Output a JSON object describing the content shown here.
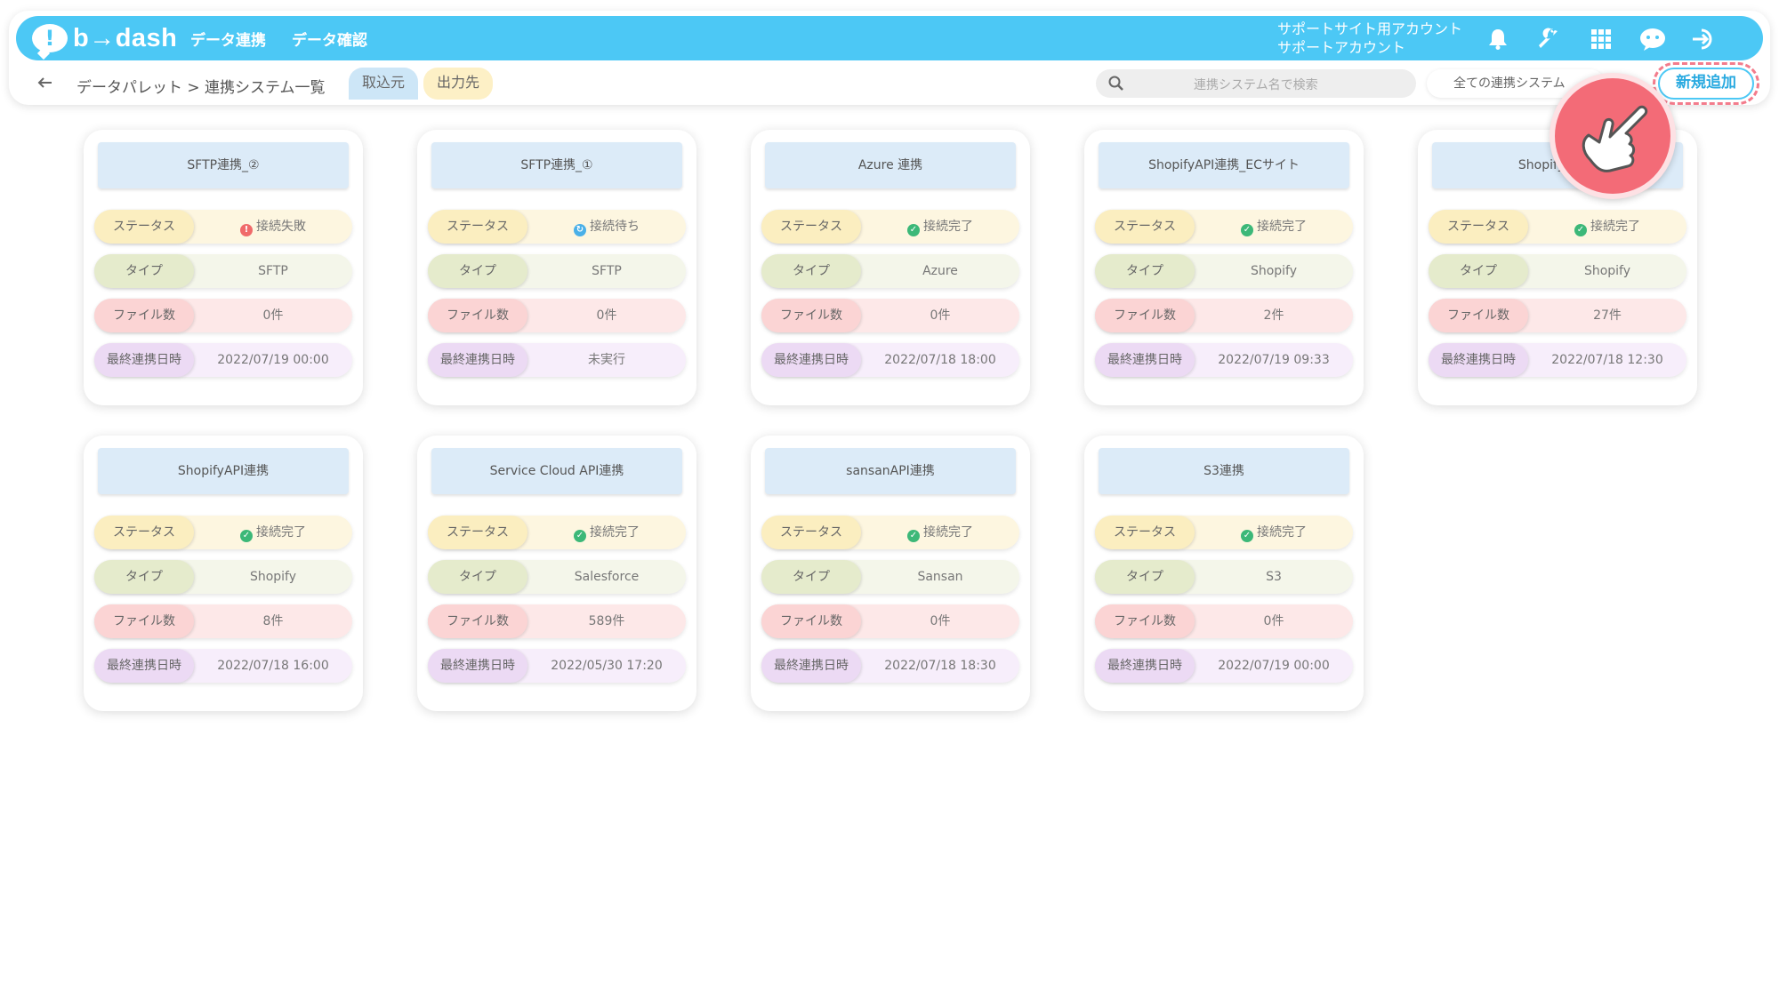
{
  "header": {
    "logo_text": "b→dash",
    "nav": [
      "データ連携",
      "データ確認"
    ],
    "account_line1": "サポートサイト用アカウント",
    "account_line2": "サポートアカウント",
    "icons": [
      "bell-icon",
      "wrench-icon",
      "grid-icon",
      "chat-icon",
      "logout-icon"
    ]
  },
  "subbar": {
    "breadcrumb": "データパレット > 連携システム一覧",
    "tab_import": "取込元",
    "tab_export": "出力先",
    "search_placeholder": "連携システム名で検索",
    "filter_value": "全ての連携システム",
    "add_button": "新規追加"
  },
  "labels": {
    "status": "ステータス",
    "type": "タイプ",
    "files": "ファイル数",
    "last_sync": "最終連携日時"
  },
  "colors": {
    "accent": "#4cc8f5",
    "ok": "#3cb878",
    "fail": "#f06a6a",
    "wait": "#4ab0e8"
  },
  "cards": [
    {
      "title": "SFTP連携_②",
      "status": "接続失敗",
      "status_kind": "fail",
      "type": "SFTP",
      "files": "0件",
      "last_sync": "2022/07/19 00:00"
    },
    {
      "title": "SFTP連携_①",
      "status": "接続待ち",
      "status_kind": "wait",
      "type": "SFTP",
      "files": "0件",
      "last_sync": "未実行"
    },
    {
      "title": "Azure 連携",
      "status": "接続完了",
      "status_kind": "ok",
      "type": "Azure",
      "files": "0件",
      "last_sync": "2022/07/18 18:00"
    },
    {
      "title": "ShopifyAPI連携_ECサイト",
      "status": "接続完了",
      "status_kind": "ok",
      "type": "Shopify",
      "files": "2件",
      "last_sync": "2022/07/19 09:33"
    },
    {
      "title": "ShopifyAPI連",
      "status": "接続完了",
      "status_kind": "ok",
      "type": "Shopify",
      "files": "27件",
      "last_sync": "2022/07/18 12:30"
    },
    {
      "title": "ShopifyAPI連携",
      "status": "接続完了",
      "status_kind": "ok",
      "type": "Shopify",
      "files": "8件",
      "last_sync": "2022/07/18 16:00"
    },
    {
      "title": "Service Cloud API連携",
      "status": "接続完了",
      "status_kind": "ok",
      "type": "Salesforce",
      "files": "589件",
      "last_sync": "2022/05/30 17:20"
    },
    {
      "title": "sansanAPI連携",
      "status": "接続完了",
      "status_kind": "ok",
      "type": "Sansan",
      "files": "0件",
      "last_sync": "2022/07/18 18:30"
    },
    {
      "title": "S3連携",
      "status": "接続完了",
      "status_kind": "ok",
      "type": "S3",
      "files": "0件",
      "last_sync": "2022/07/19 00:00"
    }
  ]
}
